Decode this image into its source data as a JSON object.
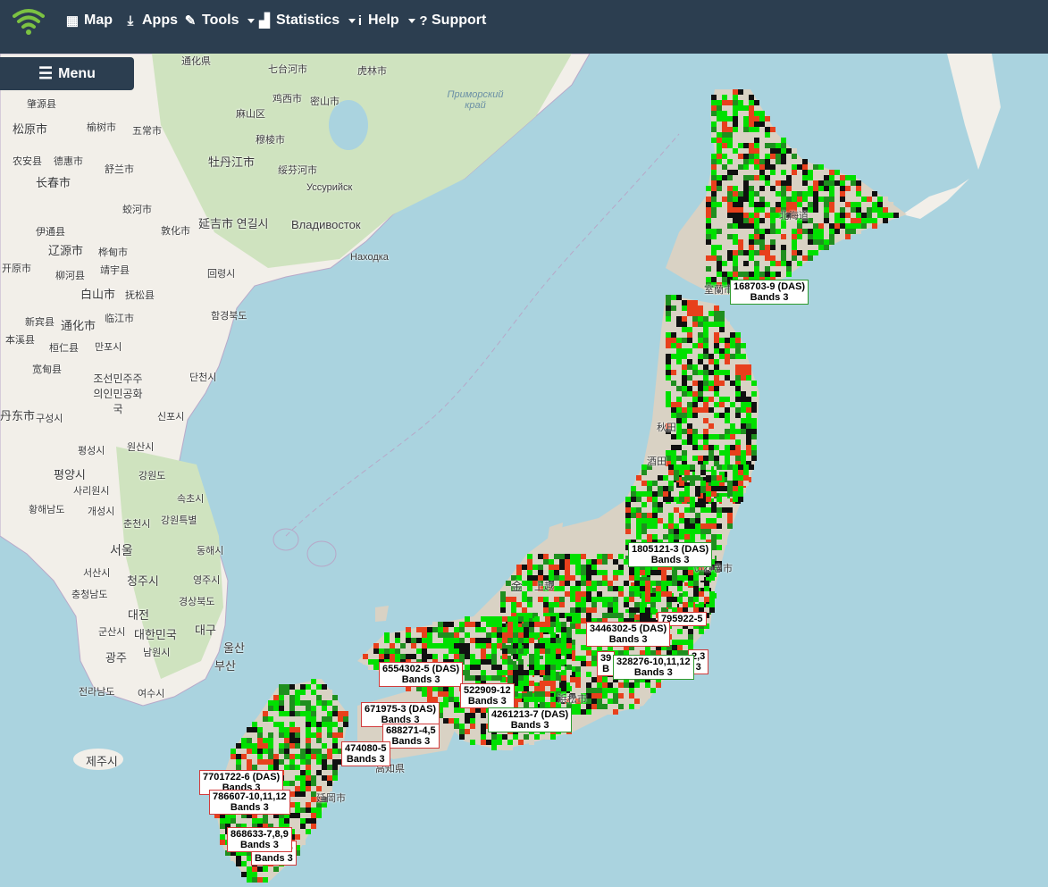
{
  "nav": {
    "items": [
      {
        "label": "Map",
        "icon": "map-icon",
        "glyph": "▦",
        "dropdown": false
      },
      {
        "label": "Apps",
        "icon": "download-icon",
        "glyph": "⤓",
        "dropdown": false
      },
      {
        "label": "Tools",
        "icon": "wrench-icon",
        "glyph": "🔧",
        "dropdown": true
      },
      {
        "label": "Statistics",
        "icon": "bar-chart-icon",
        "glyph": "▟",
        "dropdown": true
      },
      {
        "label": "Help",
        "icon": "info-icon",
        "glyph": "ℹ",
        "dropdown": true
      },
      {
        "label": "Support",
        "icon": "question-icon",
        "glyph": "?",
        "dropdown": false
      }
    ],
    "menu_label": "Menu"
  },
  "colors": {
    "navbar": "#2c3e50",
    "sea": "#aad3df",
    "land": "#f2efe9",
    "forest": "#c5dcb0",
    "signal_strong": "#00e000",
    "signal_mid": "#1f8f1f",
    "signal_weak": "#e8401c",
    "signal_none": "#101010",
    "logo": "#7cc242"
  },
  "map_labels": {
    "l1": "通化県",
    "l2": "七台河市",
    "l3": "虎林市",
    "l4": "Приморский край",
    "l5": "鸡西市",
    "l6": "密山市",
    "l7": "松原市",
    "l8": "肇源县",
    "l9": "榆树市",
    "l10": "五常市",
    "l11": "麻山区",
    "l12": "穆棱市",
    "l13": "农安县",
    "l14": "德惠市",
    "l15": "舒兰市",
    "l16": "牡丹江市",
    "l17": "绥芬河市",
    "l18": "Уссурийск",
    "l19": "长春市",
    "l20": "蛟河市",
    "l21": "延吉市 연길시",
    "l22": "Владивосток",
    "l23": "Находка",
    "l24": "伊通县",
    "l25": "敦化市",
    "l26": "辽源市",
    "l27": "桦甸市",
    "l28": "开原市",
    "l29": "柳河县",
    "l30": "靖宇县",
    "l31": "回령시",
    "l32": "白山市",
    "l33": "抚松县",
    "l34": "함경북도",
    "l35": "新宾县",
    "l36": "通化市",
    "l37": "临江市",
    "l38": "本溪县",
    "l39": "桓仁县",
    "l40": "만포시",
    "l41": "宽甸县",
    "l42": "조선민주주의인민공화국",
    "l43": "단천시",
    "l44": "丹东市",
    "l45": "구성시",
    "l46": "신포시",
    "l47": "평성시",
    "l48": "원산시",
    "l49": "평양시",
    "l50": "강원도",
    "l51": "사리원시",
    "l52": "속초시",
    "l53": "황해남도",
    "l54": "개성시",
    "l55": "춘천시",
    "l56": "강원특별",
    "l57": "서울",
    "l58": "동해시",
    "l59": "서산시",
    "l60": "청주시",
    "l61": "영주시",
    "l62": "충청남도",
    "l63": "경상북도",
    "l64": "대전",
    "l65": "대구",
    "l66": "군산시",
    "l67": "대한민국",
    "l68": "울산",
    "l69": "광주",
    "l70": "남원시",
    "l71": "부산",
    "l72": "전라남도",
    "l73": "여수시",
    "l74": "제주시",
    "l75": "北海道",
    "l76": "室蘭市",
    "l77": "秋田",
    "l78": "酒田",
    "l79": "いわき市",
    "l80": "金",
    "l81": "浜松市",
    "l82": "高知県",
    "l83": "延岡市",
    "l84": "上越"
  },
  "cell_tags": [
    {
      "id": "168703-9 (DAS)",
      "bands": "Bands 3",
      "style": "green"
    },
    {
      "id": "1805121-3 (DAS)",
      "bands": "Bands 3",
      "style": "green"
    },
    {
      "id": "795922-5",
      "bands": "",
      "style": "red"
    },
    {
      "id": "3446302-5 (DAS)",
      "bands": "Bands 3",
      "style": "red"
    },
    {
      "id": "328276-10,11,12",
      "bands": "Bands 3",
      "style": "green"
    },
    {
      "id": "39",
      "bands": "B",
      "style": "red"
    },
    {
      "id": "2,3",
      "bands": "3",
      "style": "red"
    },
    {
      "id": "6554302-5 (DAS)",
      "bands": "Bands 3",
      "style": "red"
    },
    {
      "id": "522909-12",
      "bands": "Bands 3",
      "style": "red"
    },
    {
      "id": "671975-3 (DAS)",
      "bands": "Bands 3",
      "style": "red"
    },
    {
      "id": "4261213-7 (DAS)",
      "bands": "Bands 3",
      "style": "red"
    },
    {
      "id": "688271-4,5",
      "bands": "Bands 3",
      "style": "red"
    },
    {
      "id": "474080-5",
      "bands": "Bands 3",
      "style": "red"
    },
    {
      "id": "7701722-6 (DAS)",
      "bands": "Bands 3",
      "style": "red"
    },
    {
      "id": "786607-10,11,12",
      "bands": "Bands 3",
      "style": "red"
    },
    {
      "id": "868633-7,8,9",
      "bands": "Bands 3",
      "style": "red"
    },
    {
      "id": ",5,6",
      "bands": "Bands 3",
      "style": "red"
    }
  ]
}
